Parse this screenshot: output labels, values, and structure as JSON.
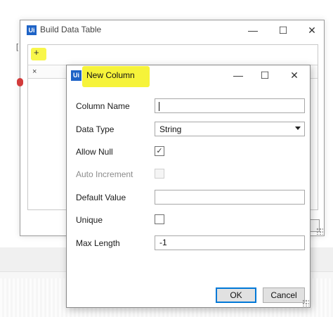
{
  "back_window": {
    "title": "Build Data Table",
    "tab_stub": "[",
    "add_column": "+",
    "delete_column": "×",
    "controls": {
      "minimize": "—",
      "maximize": "☐",
      "close": "✕"
    }
  },
  "dialog": {
    "title": "New Column",
    "logo": "Ui",
    "controls": {
      "minimize": "—",
      "maximize": "☐",
      "close": "✕"
    },
    "fields": {
      "column_name": {
        "label": "Column Name",
        "value": ""
      },
      "data_type": {
        "label": "Data Type",
        "value": "String"
      },
      "allow_null": {
        "label": "Allow Null",
        "checked": true,
        "mark": "✓"
      },
      "auto_increment": {
        "label": "Auto Increment",
        "checked": false
      },
      "default_value": {
        "label": "Default Value",
        "value": ""
      },
      "unique": {
        "label": "Unique",
        "checked": false
      },
      "max_length": {
        "label": "Max Length",
        "value": "-1"
      }
    },
    "buttons": {
      "ok": "OK",
      "cancel": "Cancel"
    }
  },
  "highlight_color": "#f6f33a"
}
